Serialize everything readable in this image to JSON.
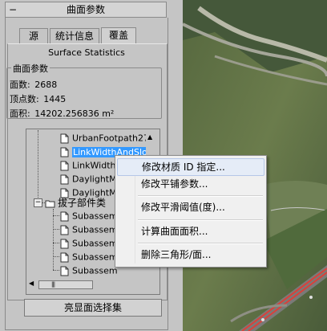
{
  "panel": {
    "rollout_title": "曲面参数",
    "rollout_toggle": "−",
    "tabs": [
      {
        "label": "源"
      },
      {
        "label": "统计信息"
      },
      {
        "label": "覆盖"
      }
    ],
    "stats_title": "Surface Statistics",
    "group_label": "曲面参数",
    "stats": {
      "faces_label": "面数:",
      "faces_value": "2688",
      "verts_label": "顶点数:",
      "verts_value": "1445",
      "area_label": "面积:",
      "area_value": "14202.256836 m²"
    },
    "tree": {
      "items": [
        {
          "label": "UrbanFootpath27"
        },
        {
          "label": "LinkWidthAndSlop"
        },
        {
          "label": "LinkWidth"
        },
        {
          "label": "DaylightM"
        },
        {
          "label": "DaylightM"
        },
        {
          "label": "拔子部件类"
        },
        {
          "label": "Subassem"
        },
        {
          "label": "Subassem"
        },
        {
          "label": "Subassem"
        },
        {
          "label": "Subassem"
        },
        {
          "label": "Subassem"
        }
      ]
    },
    "bottom_button": "亮显面选择集"
  },
  "context_menu": {
    "items": [
      {
        "label": "修改材质 ID 指定..."
      },
      {
        "label": "修改平铺参数..."
      },
      {
        "label": "修改平滑阈值(度)..."
      },
      {
        "label": "计算曲面面积..."
      },
      {
        "label": "删除三角形/面..."
      }
    ]
  }
}
